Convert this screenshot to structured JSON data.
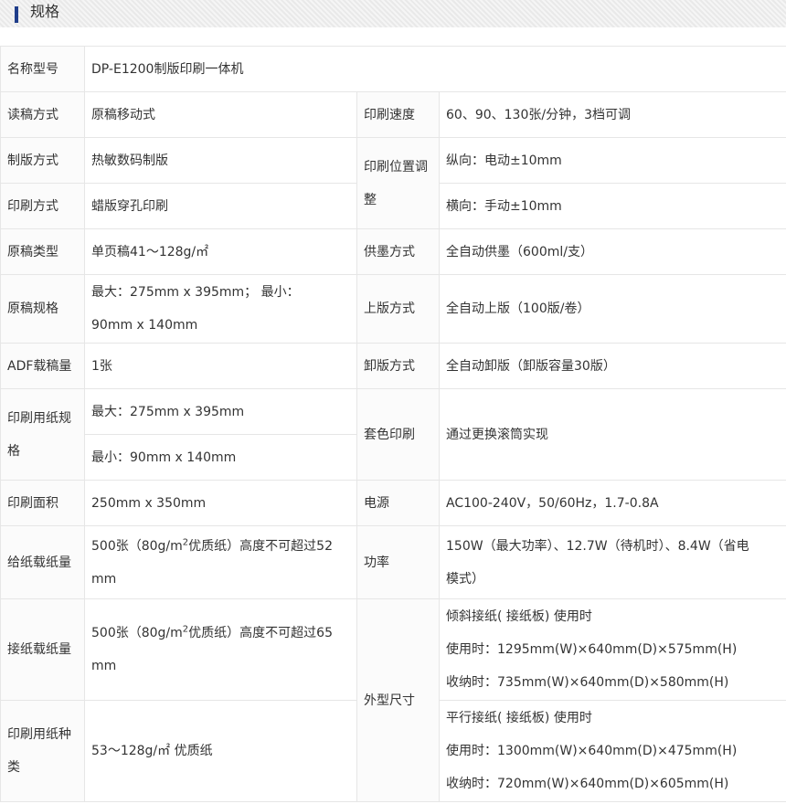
{
  "section": {
    "title": "规格"
  },
  "rows": {
    "model": {
      "label": "名称型号",
      "value": "DP-E1200制版印刷一体机"
    },
    "read_method": {
      "label": "读稿方式",
      "value": "原稿移动式"
    },
    "print_speed": {
      "label": "印刷速度",
      "value": "60、90、130张/分钟，3档可调"
    },
    "plate_method": {
      "label": "制版方式",
      "value": "热敏数码制版"
    },
    "position_adjust": {
      "label_line1": "印刷位置调",
      "label_line2": "整",
      "value_v": "纵向：电动±10mm",
      "value_h": "横向：手动±10mm"
    },
    "print_method": {
      "label": "印刷方式",
      "value": "蜡版穿孔印刷"
    },
    "original_type": {
      "label": "原稿类型",
      "value": "单页稿41～128g/㎡"
    },
    "ink_supply": {
      "label": "供墨方式",
      "value": "全自动供墨（600ml/支）"
    },
    "original_size": {
      "label": "原稿规格",
      "value_line1": "最大：275mm x 395mm； 最小：",
      "value_line2": "90mm x 140mm"
    },
    "plate_loading": {
      "label": "上版方式",
      "value": "全自动上版（100版/卷）"
    },
    "adf_capacity": {
      "label": "ADF载稿量",
      "value": "1张"
    },
    "plate_unloading": {
      "label": "卸版方式",
      "value": "全自动卸版（卸版容量30版）"
    },
    "paper_size": {
      "label_line1": "印刷用纸规",
      "label_line2": "格",
      "value_max": "最大：275mm x 395mm",
      "value_min": "最小：90mm x 140mm"
    },
    "color_print": {
      "label": "套色印刷",
      "value": "通过更换滚筒实现"
    },
    "print_area": {
      "label": "印刷面积",
      "value": "250mm x 350mm"
    },
    "power": {
      "label": "电源",
      "value": "AC100-240V，50/60Hz，1.7-0.8A"
    },
    "feed_capacity": {
      "label": "给纸载纸量",
      "value_pre": "500张（80g/m",
      "value_sup": "2",
      "value_post": "优质纸）高度不可超过52",
      "value_line2": "mm"
    },
    "power_consumption": {
      "label": "功率",
      "value_line1": "150W（最大功率）、12.7W（待机时）、8.4W（省电",
      "value_line2": "模式）"
    },
    "receive_capacity": {
      "label": "接纸载纸量",
      "value_pre": "500张（80g/m",
      "value_sup": "2",
      "value_post": "优质纸）高度不可超过65",
      "value_line2": "mm"
    },
    "dimensions": {
      "label": "外型尺寸",
      "tilt_title": "倾斜接纸( 接纸板) 使用时",
      "tilt_use": "使用时：1295mm(W)×640mm(D)×575mm(H)",
      "tilt_store": "收纳时：735mm(W)×640mm(D)×580mm(H)",
      "parallel_title": "平行接纸( 接纸板) 使用时",
      "parallel_use": "使用时：1300mm(W)×640mm(D)×475mm(H)",
      "parallel_store": "收纳时：720mm(W)×640mm(D)×605mm(H)"
    },
    "paper_type": {
      "label_line1": "印刷用纸种",
      "label_line2": "类",
      "value": "53～128g/㎡ 优质纸"
    }
  },
  "colors": {
    "accent_bar": "#1f3d8a",
    "border": "#e6e6e6",
    "header_bg": "#e9e9e9"
  }
}
